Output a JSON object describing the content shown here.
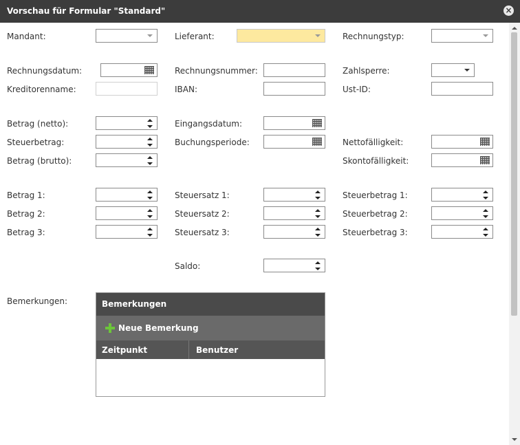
{
  "window": {
    "title": "Vorschau für Formular \"Standard\"",
    "close_icon": "close-icon"
  },
  "labels": {
    "mandant": "Mandant:",
    "lieferant": "Lieferant:",
    "rechnungstyp": "Rechnungstyp:",
    "rechnungsdatum": "Rechnungsdatum:",
    "rechnungsnummer": "Rechnungsnummer:",
    "zahlsperre": "Zahlsperre:",
    "kreditorenname": "Kreditorenname:",
    "iban": "IBAN:",
    "ustid": "Ust-ID:",
    "betrag_netto": "Betrag (netto):",
    "eingangsdatum": "Eingangsdatum:",
    "steuerbetrag": "Steuerbetrag:",
    "buchungsperiode": "Buchungsperiode:",
    "nettofaelligkeit": "Nettofälligkeit:",
    "betrag_brutto": "Betrag (brutto):",
    "skontofaelligkeit": "Skontofälligkeit:",
    "betrag1": "Betrag 1:",
    "betrag2": "Betrag 2:",
    "betrag3": "Betrag 3:",
    "steuersatz1": "Steuersatz 1:",
    "steuersatz2": "Steuersatz 2:",
    "steuersatz3": "Steuersatz 3:",
    "steuerbetrag1": "Steuerbetrag 1:",
    "steuerbetrag2": "Steuerbetrag 2:",
    "steuerbetrag3": "Steuerbetrag 3:",
    "saldo": "Saldo:",
    "bemerkungen": "Bemerkungen:"
  },
  "bemerkungen_panel": {
    "title": "Bemerkungen",
    "add_button": "Neue Bemerkung",
    "columns": [
      "Zeitpunkt",
      "Benutzer"
    ]
  },
  "colors": {
    "titlebar": "#3c3c3c",
    "highlight_field": "#fde99f",
    "add_icon": "#6cc63a"
  }
}
